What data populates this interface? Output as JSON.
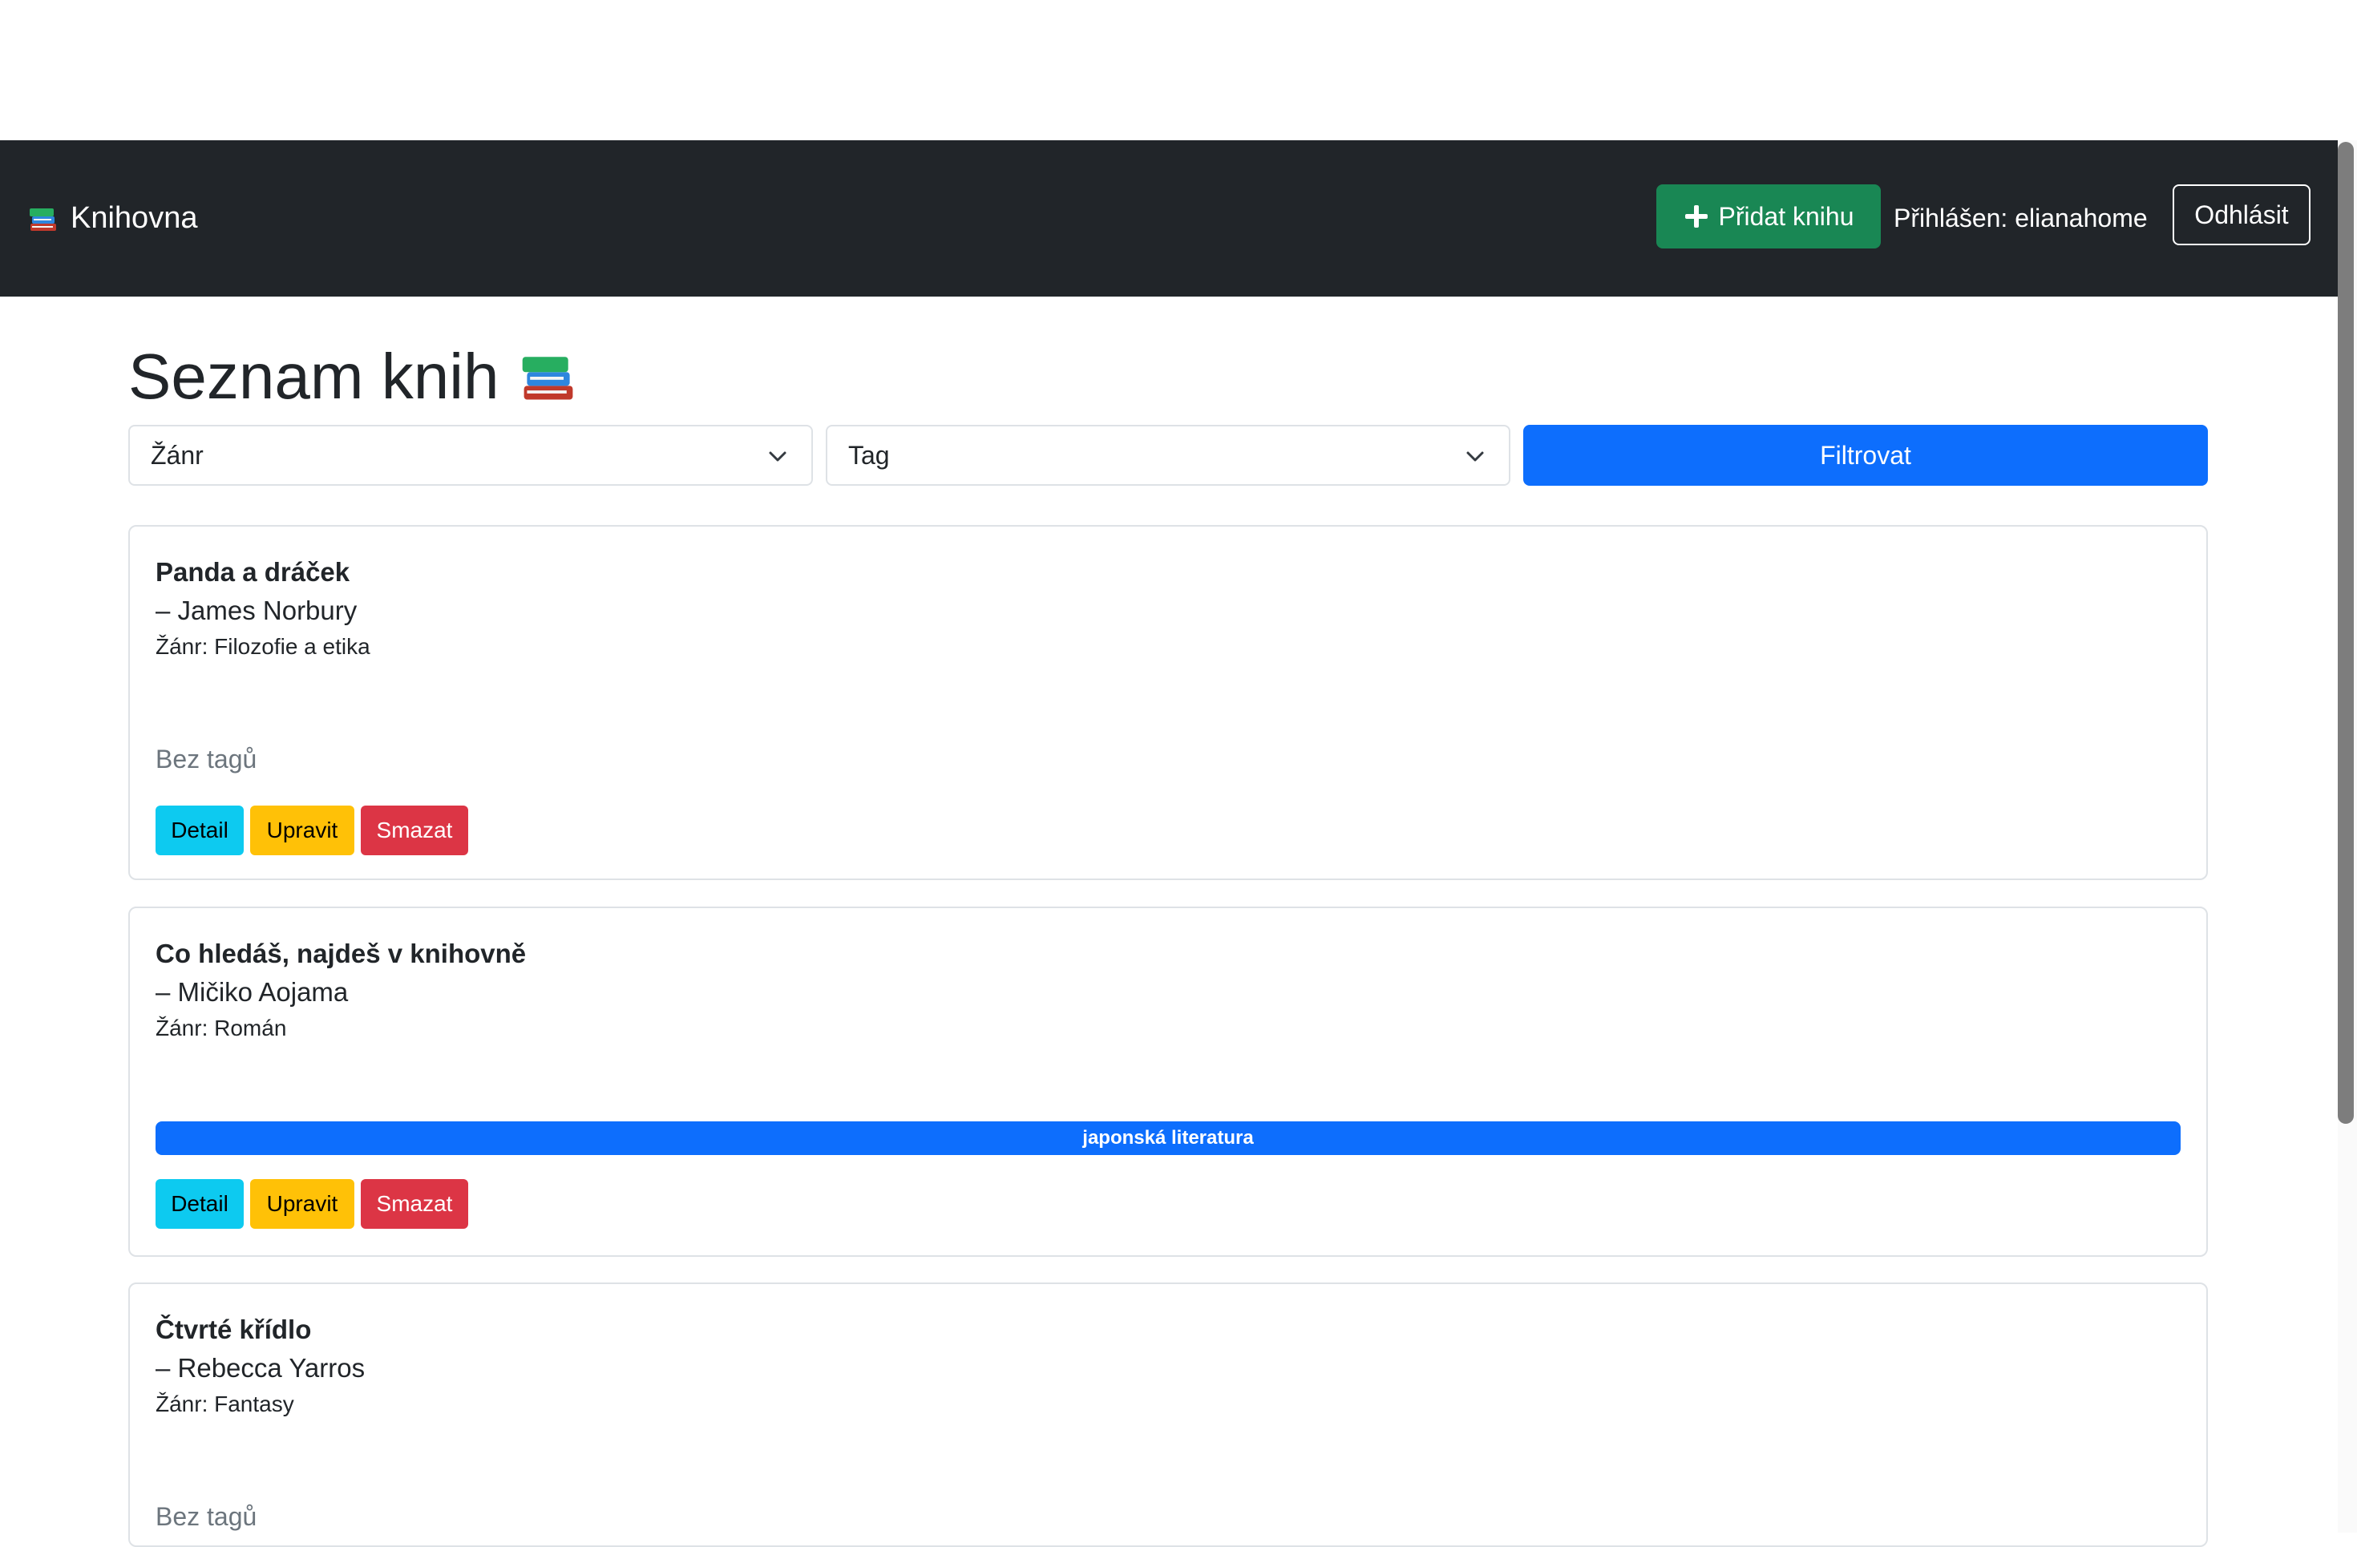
{
  "navbar": {
    "brand": "Knihovna",
    "brand_icon": "books-icon",
    "add_book_label": "Přidat knihu",
    "logged_in_text": "Přihlášen: elianahome",
    "logout_label": "Odhlásit"
  },
  "page": {
    "title": "Seznam knih",
    "title_icon": "books-icon"
  },
  "filters": {
    "genre_value": "Žánr",
    "tag_value": "Tag",
    "filter_label": "Filtrovat"
  },
  "books": [
    {
      "title": "Panda a dráček",
      "author": "– James Norbury",
      "genre": "Žánr: Filozofie a etika",
      "tags_text": "Bez tagů",
      "detail_label": "Detail",
      "edit_label": "Upravit",
      "delete_label": "Smazat"
    },
    {
      "title": "Co hledáš, najdeš v knihovně",
      "author": "– Mičiko Aojama",
      "genre": "Žánr: Román",
      "tag": "japonská literatura",
      "detail_label": "Detail",
      "edit_label": "Upravit",
      "delete_label": "Smazat"
    },
    {
      "title": "Čtvrté křídlo",
      "author": "– Rebecca Yarros",
      "genre": "Žánr: Fantasy",
      "tags_text": "Bez tagů"
    }
  ],
  "colors": {
    "navbar_bg": "#212529",
    "add_button": "#198754",
    "filter_button": "#0d6efd",
    "detail_button": "#0dcaf0",
    "edit_button": "#ffc107",
    "delete_button": "#dc3545",
    "tag_badge": "#0d6efd"
  }
}
